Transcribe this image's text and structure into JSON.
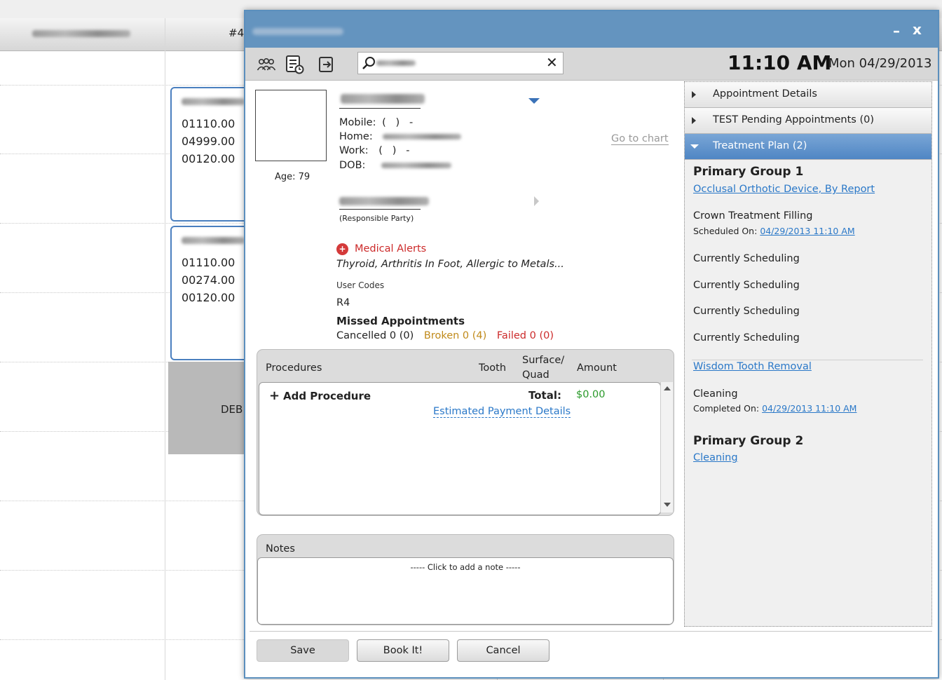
{
  "schedule": {
    "column_header_partial": "#4",
    "cards": [
      {
        "codes": [
          "01110.00",
          "04999.00",
          "00120.00"
        ]
      },
      {
        "codes": [
          "01110.00",
          "00274.00",
          "00120.00"
        ]
      }
    ],
    "block_label_partial": "DEB"
  },
  "dialog": {
    "minimize_label": "–",
    "close_label": "x",
    "search": {
      "clear_label": "✕"
    },
    "time": "11:10 AM",
    "date": "Mon 04/29/2013"
  },
  "patient": {
    "age_label": "Age: 79",
    "mobile_label": "Mobile:",
    "mobile_value": "(   )   -",
    "home_label": "Home:",
    "work_label": "Work:",
    "work_value": "(   )   -",
    "dob_label": "DOB:",
    "go_to_chart": "Go to chart",
    "responsible_party_label": "(Responsible Party)",
    "medical_alerts_title": "Medical Alerts",
    "medical_alerts_list": "Thyroid, Arthritis In Foot, Allergic to Metals...",
    "user_codes_title": "User Codes",
    "user_codes_value": "R4",
    "missed_title": "Missed Appointments",
    "missed_cancelled": "Cancelled 0 (0)",
    "missed_broken": "Broken 0 (4)",
    "missed_failed": "Failed 0 (0)"
  },
  "procedures": {
    "headers": {
      "procedures": "Procedures",
      "tooth": "Tooth",
      "surface_line1": "Surface/",
      "surface_line2": "Quad",
      "amount": "Amount"
    },
    "add_label": "Add Procedure",
    "total_label": "Total:",
    "total_amount": "$0.00",
    "estimated_payment": "Estimated Payment Details"
  },
  "notes": {
    "title": "Notes",
    "placeholder": "----- Click to add a note -----"
  },
  "right_panel": {
    "sections": [
      {
        "label": "Appointment Details",
        "expanded": false
      },
      {
        "label": "TEST Pending Appointments (0)",
        "expanded": false
      },
      {
        "label": "Treatment Plan (2)",
        "expanded": true
      }
    ],
    "group1_title": "Primary Group 1",
    "group1_link": "Occlusal Orthotic Device, By Report",
    "crown_title": "Crown Treatment Filling",
    "scheduled_on_label": "Scheduled On:",
    "scheduled_on_value": "04/29/2013 11:10 AM",
    "currently_scheduling": [
      "Currently Scheduling",
      "Currently Scheduling",
      "Currently Scheduling",
      "Currently Scheduling"
    ],
    "wisdom_link": "Wisdom Tooth Removal",
    "cleaning_title": "Cleaning",
    "completed_on_label": "Completed On:",
    "completed_on_value": "04/29/2013 11:10 AM",
    "group2_title": "Primary Group 2",
    "group2_link": "Cleaning"
  },
  "buttons": {
    "save": "Save",
    "book": "Book It!",
    "cancel": "Cancel"
  },
  "colors": {
    "accent": "#6494bf",
    "alert_red": "#cc2a2a",
    "broken_orange": "#c08a1a",
    "money_green": "#2a9a2a",
    "link_blue": "#2a78c8"
  },
  "icons": {
    "toolbar": [
      "family-icon",
      "appointment-list-icon",
      "exit-icon",
      "search-icon"
    ]
  }
}
